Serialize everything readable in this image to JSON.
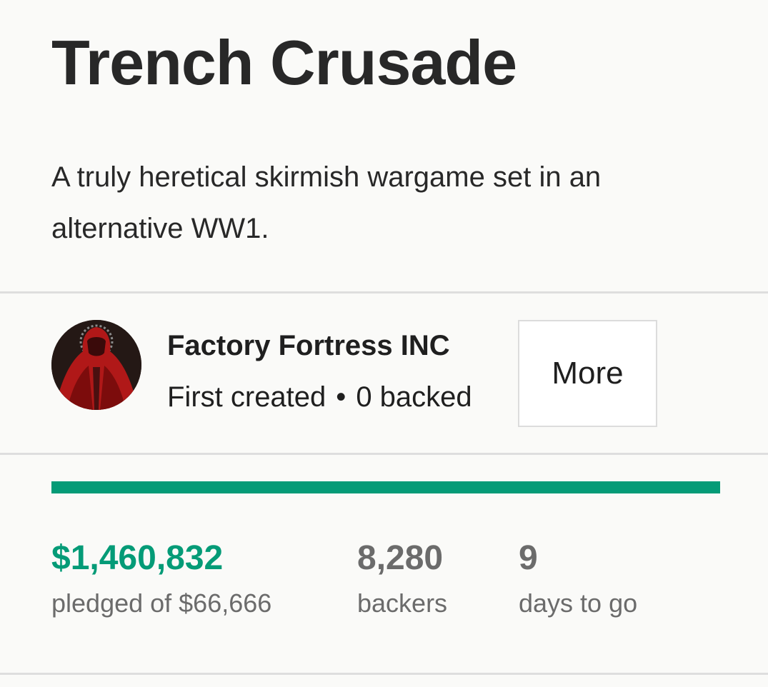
{
  "project": {
    "title": "Trench Crusade",
    "blurb": "A truly heretical skirmish wargame set in an alternative WW1."
  },
  "creator": {
    "name": "Factory Fortress INC",
    "status": "First created",
    "separator": "•",
    "backed": "0 backed",
    "more_label": "More",
    "avatar_icon": "hooded-red-figure-avatar"
  },
  "funding": {
    "progress_fraction": 1.0,
    "pledged": "$1,460,832",
    "pledged_label": "pledged of $66,666",
    "backers": "8,280",
    "backers_label": "backers",
    "days": "9",
    "days_label": "days to go"
  },
  "colors": {
    "accent": "#049b77",
    "stat_gray": "#6b6b6b",
    "divider": "#dedede",
    "background": "#fafaf8"
  }
}
